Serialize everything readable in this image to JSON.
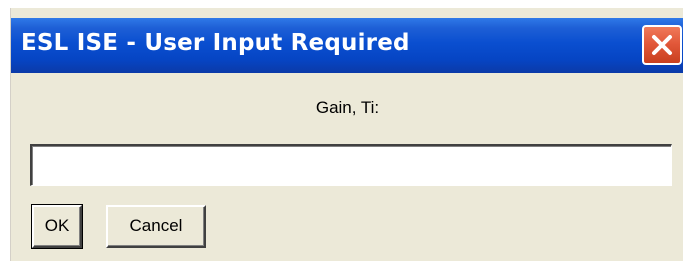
{
  "window": {
    "title": "ESL ISE - User Input Required"
  },
  "dialog": {
    "prompt": "Gain, Ti:",
    "input_value": "",
    "ok_label": "OK",
    "cancel_label": "Cancel"
  },
  "icons": {
    "close": "close-icon"
  },
  "colors": {
    "titlebar": "#0a4fd0",
    "dialog_bg": "#ece9d8",
    "close_button": "#e2583a"
  }
}
